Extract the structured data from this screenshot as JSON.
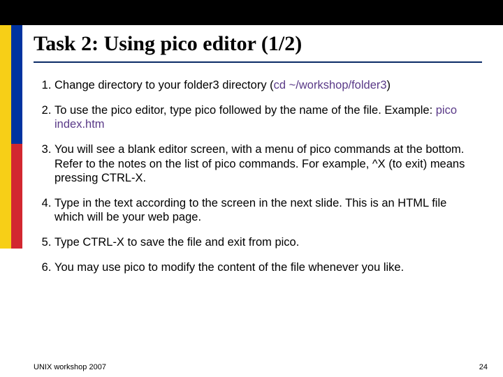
{
  "slide": {
    "title": "Task 2: Using pico editor (1/2)",
    "steps": {
      "s1a": "Change directory to your folder3 directory (",
      "s1b": "cd ~/workshop/folder3",
      "s1c": ")",
      "s2a": "To use the pico editor, type pico followed by the name of the file. Example: ",
      "s2b": "pico index.htm",
      "s3": "You will see a blank editor screen, with a menu of pico commands at the bottom. Refer to the notes on the list of pico commands. For example, ^X (to exit) means pressing CTRL-X.",
      "s4": "Type in the text according to the screen in the next slide. This is an HTML file which will be your web page.",
      "s5": "Type CTRL-X to save the file and exit from pico.",
      "s6": "You may use pico to modify the content of the file whenever you like."
    },
    "footer_left": "UNIX workshop 2007",
    "footer_right": "24"
  }
}
